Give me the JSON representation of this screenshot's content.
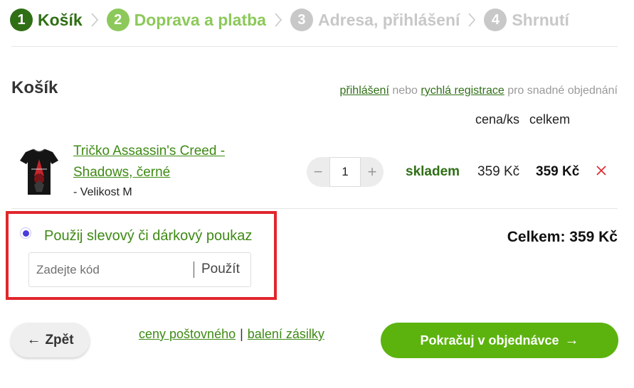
{
  "steps": [
    {
      "num": "1",
      "label": "Košík",
      "state": "active"
    },
    {
      "num": "2",
      "label": "Doprava a platba",
      "state": "next"
    },
    {
      "num": "3",
      "label": "Adresa, přihlášení",
      "state": "future"
    },
    {
      "num": "4",
      "label": "Shrnutí",
      "state": "future"
    }
  ],
  "cart": {
    "title": "Košík",
    "login_link": "přihlášení",
    "or_text": " nebo ",
    "register_link": "rychlá registrace",
    "suffix_text": " pro snadné objednání",
    "col_unit_price": "cena/ks",
    "col_total": "celkem"
  },
  "item": {
    "name": "Tričko Assassin's Creed - Shadows, černé",
    "variant": "- Velikost M",
    "qty": "1",
    "qty_minus": "−",
    "qty_plus": "+",
    "stock": "skladem",
    "unit_price": "359 Kč",
    "total": "359 Kč"
  },
  "voucher": {
    "label": "Použij slevový či dárkový poukaz",
    "placeholder": "Zadejte kód",
    "apply": "Použít"
  },
  "summary": {
    "total": "Celkem: 359 Kč"
  },
  "actions": {
    "back_arrow": "←",
    "back": "Zpět",
    "shipping_prices": "ceny poštovného",
    "link_sep": "|",
    "packaging": "balení zásilky",
    "continue": "Pokračuj v objednávce",
    "continue_arrow": "→"
  },
  "colors": {
    "brand_green": "#5cb30e",
    "dark_green": "#2f6f16",
    "highlight_red": "#e1262d",
    "remove_red": "#e1262d"
  }
}
